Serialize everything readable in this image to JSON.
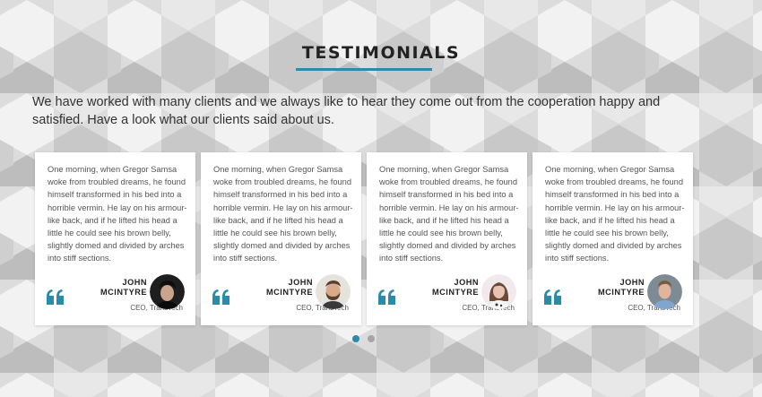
{
  "section": {
    "title": "TESTIMONIALS",
    "intro": "We have worked with many clients and we always like to hear they come out from the cooperation happy and satisfied. Have a look what our clients said about us.",
    "accent_color": "#2a8bab"
  },
  "testimonials": [
    {
      "text": "One morning, when Gregor Samsa woke from troubled dreams, he found himself transformed in his bed into a horrible vermin. He lay on his armour-like back, and if he lifted his head a little he could see his brown belly, slightly domed and divided by arches into stiff sections.",
      "name_line1": "JOHN",
      "name_line2": "MCINTYRE",
      "role": "CEO, TransTech",
      "avatar": "man-dark-hair-avatar",
      "quote_icon": "quote-icon"
    },
    {
      "text": "One morning, when Gregor Samsa woke from troubled dreams, he found himself transformed in his bed into a horrible vermin. He lay on his armour-like back, and if he lifted his head a little he could see his brown belly, slightly domed and divided by arches into stiff sections.",
      "name_line1": "JOHN",
      "name_line2": "MCINTYRE",
      "role": "CEO, TransTech",
      "avatar": "bearded-man-avatar",
      "quote_icon": "quote-icon"
    },
    {
      "text": "One morning, when Gregor Samsa woke from troubled dreams, he found himself transformed in his bed into a horrible vermin. He lay on his armour-like back, and if he lifted his head a little he could see his brown belly, slightly domed and divided by arches into stiff sections.",
      "name_line1": "JOHN",
      "name_line2": "MCINTYRE",
      "role": "CEO, TransTech",
      "avatar": "woman-avatar",
      "quote_icon": "quote-icon"
    },
    {
      "text": "One morning, when Gregor Samsa woke from troubled dreams, he found himself transformed in his bed into a horrible vermin. He lay on his armour-like back, and if he lifted his head a little he could see his brown belly, slightly domed and divided by arches into stiff sections.",
      "name_line1": "JOHN",
      "name_line2": "MCINTYRE",
      "role": "CEO, TransTech",
      "avatar": "man-blue-shirt-avatar",
      "quote_icon": "quote-icon"
    }
  ],
  "pagination": {
    "active_color": "#2a8bab",
    "inactive_color": "#a6a6a6",
    "active_index": 0,
    "total": 2
  }
}
